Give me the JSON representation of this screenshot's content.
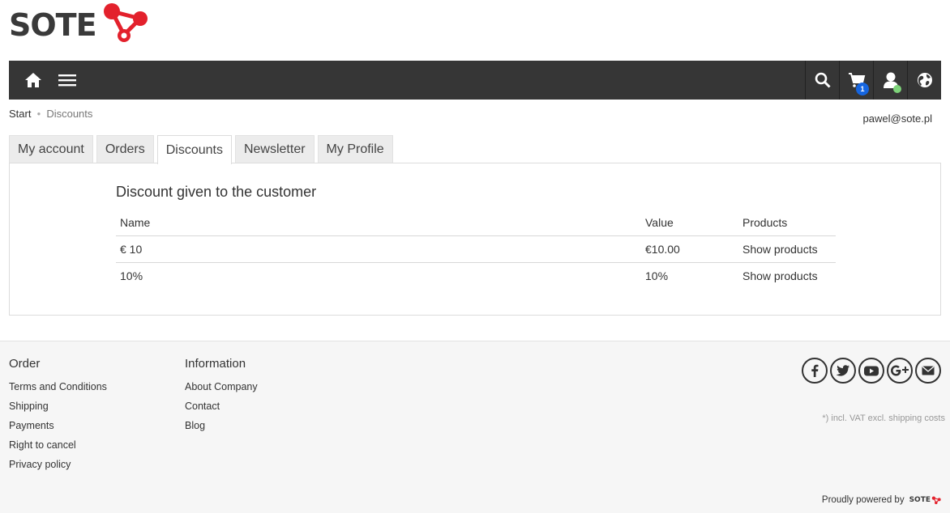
{
  "brand": {
    "name": "SOTE",
    "accent": "#e3212c"
  },
  "navbar": {
    "left": [
      {
        "icon": "home-icon"
      },
      {
        "icon": "menu-icon"
      }
    ],
    "right": [
      {
        "icon": "search-icon"
      },
      {
        "icon": "cart-icon",
        "badge": "1"
      },
      {
        "icon": "user-icon"
      },
      {
        "icon": "globe-icon"
      }
    ]
  },
  "breadcrumb": {
    "items": [
      "Start",
      "Discounts"
    ]
  },
  "user": {
    "email": "pawel@sote.pl"
  },
  "tabs": [
    {
      "label": "My account"
    },
    {
      "label": "Orders"
    },
    {
      "label": "Discounts",
      "active": true
    },
    {
      "label": "Newsletter"
    },
    {
      "label": "My Profile"
    }
  ],
  "discounts": {
    "title": "Discount given to the customer",
    "columns": [
      "Name",
      "Value",
      "Products"
    ],
    "rows": [
      {
        "name": "€ 10",
        "value": "€10.00",
        "products": "Show products"
      },
      {
        "name": "10%",
        "value": "10%",
        "products": "Show products"
      }
    ]
  },
  "footer": {
    "order": {
      "heading": "Order",
      "links": [
        "Terms and Conditions",
        "Shipping",
        "Payments",
        "Right to cancel",
        "Privacy policy"
      ]
    },
    "information": {
      "heading": "Information",
      "links": [
        "About Company",
        "Contact",
        "Blog"
      ]
    },
    "socials": [
      "facebook-icon",
      "twitter-icon",
      "youtube-icon",
      "google-plus-icon",
      "email-icon"
    ],
    "vat_note": "*) incl. VAT excl. shipping costs",
    "powered_by": "Proudly powered by",
    "powered_brand": "SOTE"
  }
}
